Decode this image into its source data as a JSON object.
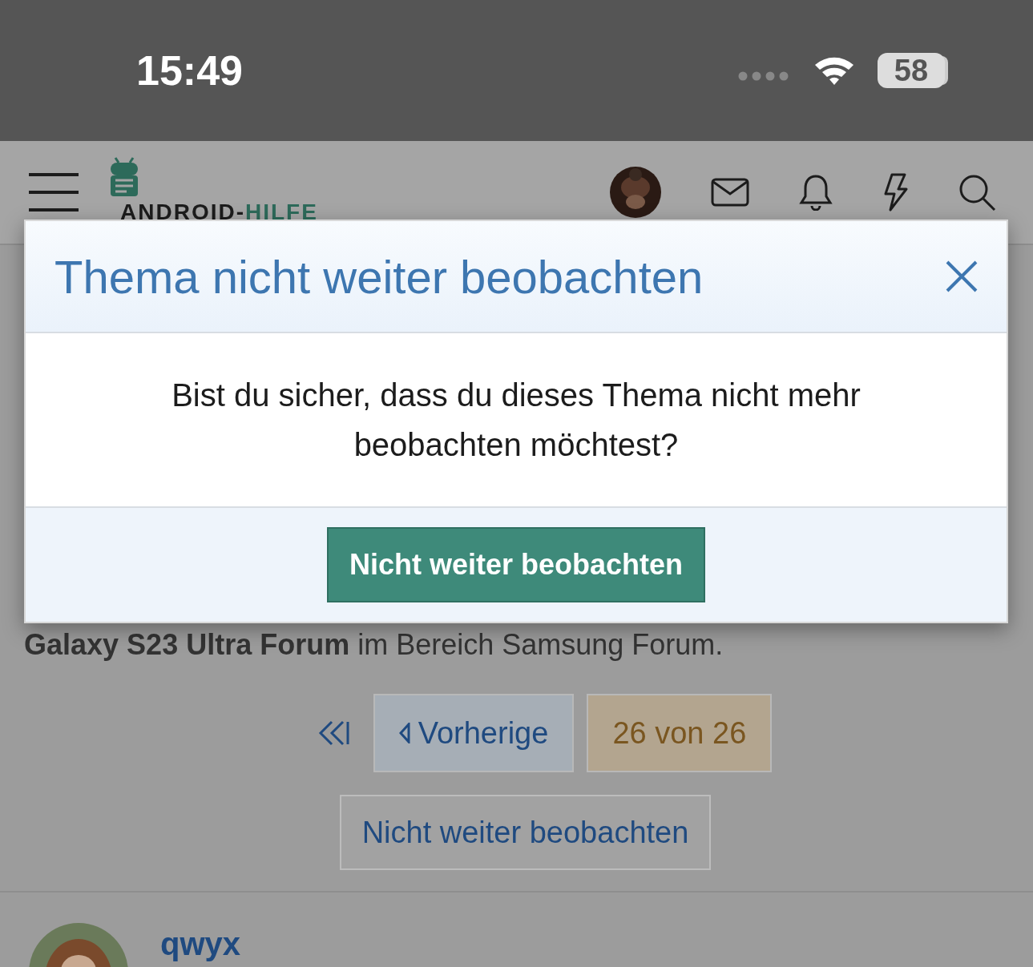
{
  "status_bar": {
    "time": "15:49",
    "battery": "58"
  },
  "header": {
    "logo_part_1": "ANDROID-",
    "logo_part_2": "HILFE"
  },
  "page": {
    "text": "**Galaxy S23 Ultra Forum** im Bereich Samsung Forum.",
    "pagination": {
      "previous": "Vorherige",
      "current": "26 von 26"
    },
    "watch_button": "Nicht weiter beobachten",
    "post": {
      "author": "qwyx"
    }
  },
  "dialog": {
    "title": "Thema nicht weiter beobachten",
    "message": "Bist du sicher, dass du dieses Thema nicht mehr beobachten möchtest?",
    "confirm_button": "Nicht weiter beobachten"
  }
}
